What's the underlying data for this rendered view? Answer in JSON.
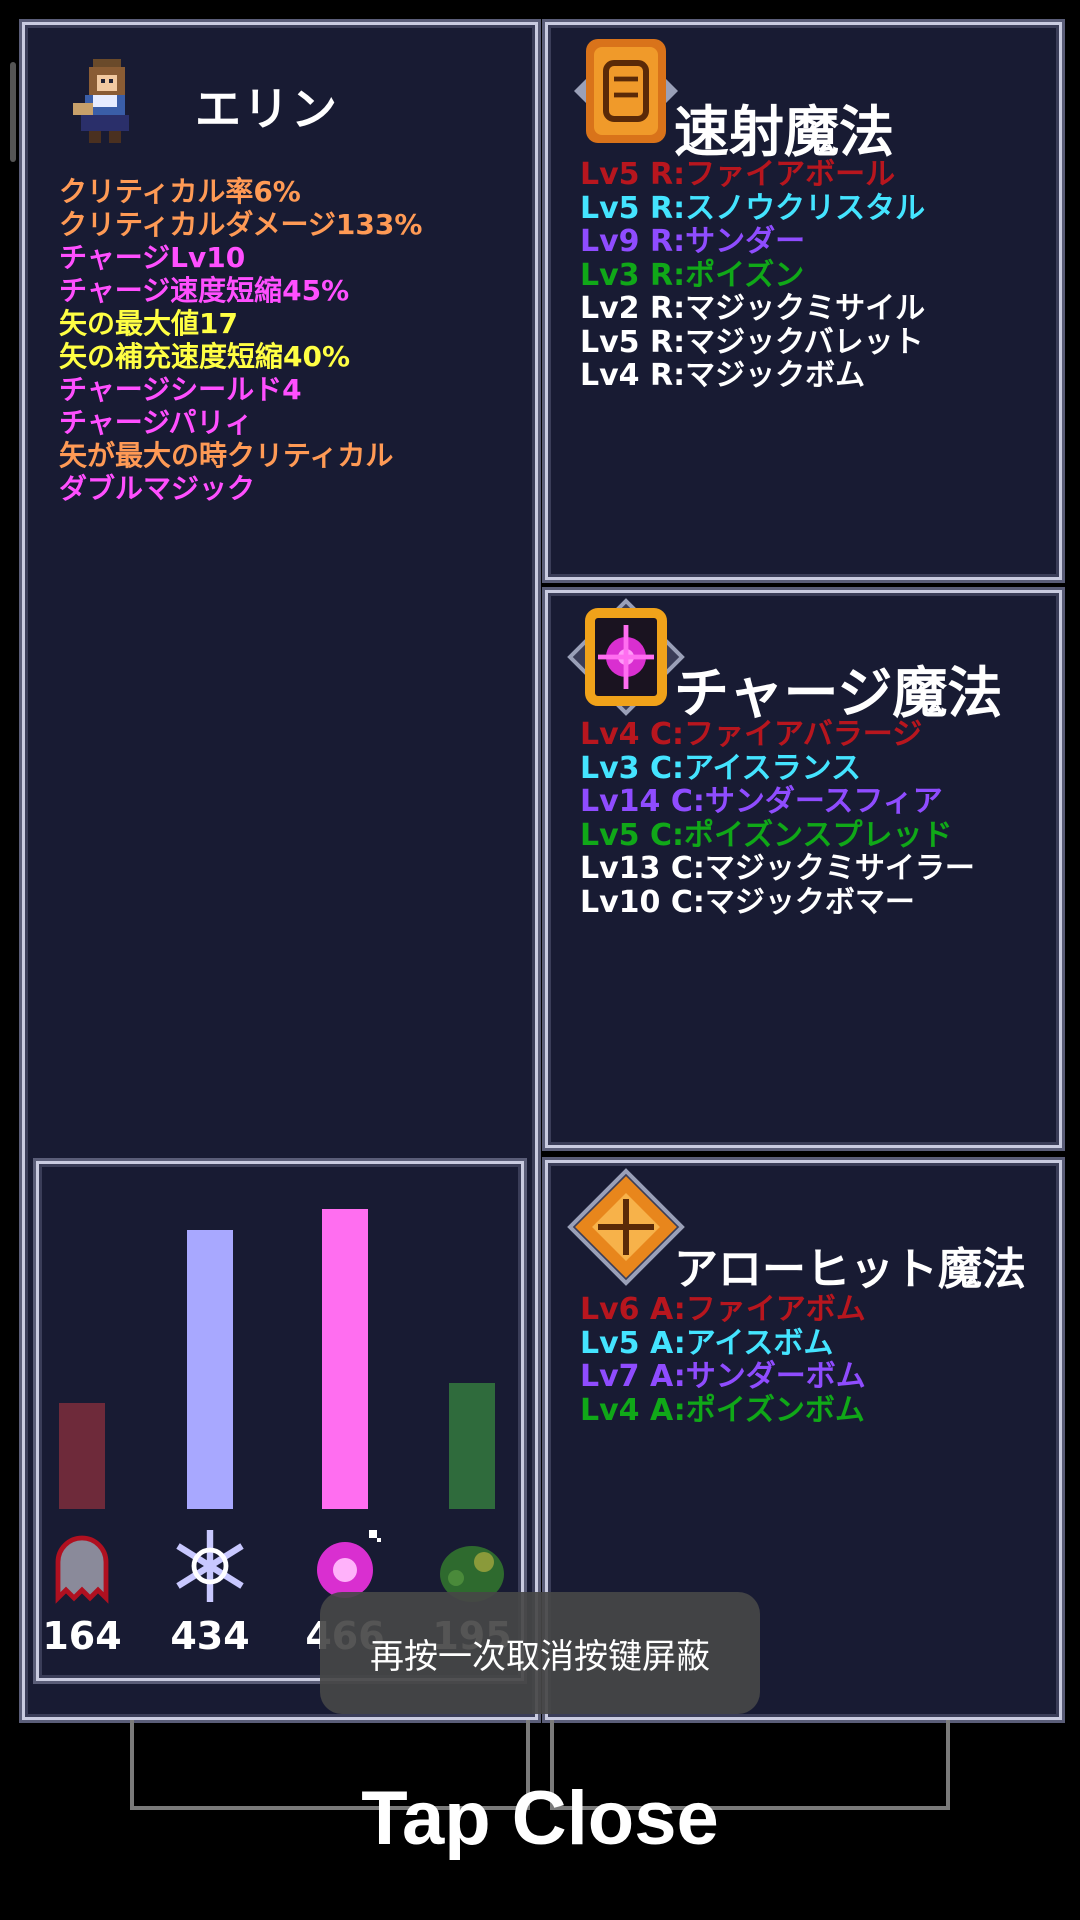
{
  "character": {
    "name": "エリン",
    "traits": [
      {
        "text": "クリティカル率6%",
        "color": "#ff9a55"
      },
      {
        "text": "クリティカルダメージ133%",
        "color": "#ff9a55"
      },
      {
        "text": "チャージLv10",
        "color": "#ff4fff"
      },
      {
        "text": "チャージ速度短縮45%",
        "color": "#ff4fff"
      },
      {
        "text": "矢の最大値17",
        "color": "#ffff44"
      },
      {
        "text": "矢の補充速度短縮40%",
        "color": "#ffff44"
      },
      {
        "text": "チャージシールド4",
        "color": "#ff4fff"
      },
      {
        "text": "チャージパリィ",
        "color": "#ff4fff"
      },
      {
        "text": "矢が最大の時クリティカル",
        "color": "#ff9a55"
      },
      {
        "text": "ダブルマジック",
        "color": "#ff4fff"
      }
    ]
  },
  "rapid_magic": {
    "title": "速射魔法",
    "icon": "rapid-fire-scroll-icon",
    "items": [
      {
        "text": "Lv5 R:ファイアボール",
        "color": "#b8161e"
      },
      {
        "text": "Lv5 R:スノウクリスタル",
        "color": "#44e4ff"
      },
      {
        "text": "Lv9 R:サンダー",
        "color": "#8f4cff"
      },
      {
        "text": "Lv3 R:ポイズン",
        "color": "#10a818"
      },
      {
        "text": "Lv2 R:マジックミサイル",
        "color": "#ffffff"
      },
      {
        "text": "Lv5 R:マジックバレット",
        "color": "#ffffff"
      },
      {
        "text": "Lv4 R:マジックボム",
        "color": "#ffffff"
      }
    ]
  },
  "charge_magic": {
    "title": "チャージ魔法",
    "icon": "charge-crosshair-icon",
    "items": [
      {
        "text": "Lv4 C:ファイアバラージ",
        "color": "#b8161e"
      },
      {
        "text": "Lv3 C:アイスランス",
        "color": "#44e4ff"
      },
      {
        "text": "Lv14 C:サンダースフィア",
        "color": "#8f4cff"
      },
      {
        "text": "Lv5 C:ポイズンスプレッド",
        "color": "#10a818"
      },
      {
        "text": "Lv13 C:マジックミサイラー",
        "color": "#ffffff"
      },
      {
        "text": "Lv10 C:マジックボマー",
        "color": "#ffffff"
      }
    ]
  },
  "arrowhit_magic": {
    "title": "アローヒット魔法",
    "icon": "arrow-hit-scroll-icon",
    "items": [
      {
        "text": "Lv6 A:ファイアボム",
        "color": "#b8161e"
      },
      {
        "text": "Lv5 A:アイスボム",
        "color": "#44e4ff"
      },
      {
        "text": "Lv7 A:サンダーボム",
        "color": "#8f4cff"
      },
      {
        "text": "Lv4 A:ポイズンボム",
        "color": "#10a818"
      }
    ]
  },
  "element_stats": {
    "max": 466,
    "items": [
      {
        "name": "fire",
        "icon": "fire-ghost-icon",
        "count": "164",
        "value": 164,
        "color": "#6e2a3a"
      },
      {
        "name": "ice",
        "icon": "snowflake-icon",
        "count": "434",
        "value": 434,
        "color": "#a8a8ff"
      },
      {
        "name": "thunder",
        "icon": "thunder-orb-icon",
        "count": "466",
        "value": 466,
        "color": "#ff6ef0"
      },
      {
        "name": "poison",
        "icon": "poison-blob-icon",
        "count": "195",
        "value": 195,
        "color": "#2f6b3c"
      }
    ]
  },
  "toast": {
    "text": "再按一次取消按键屏蔽"
  },
  "close": {
    "label": "Tap Close"
  }
}
